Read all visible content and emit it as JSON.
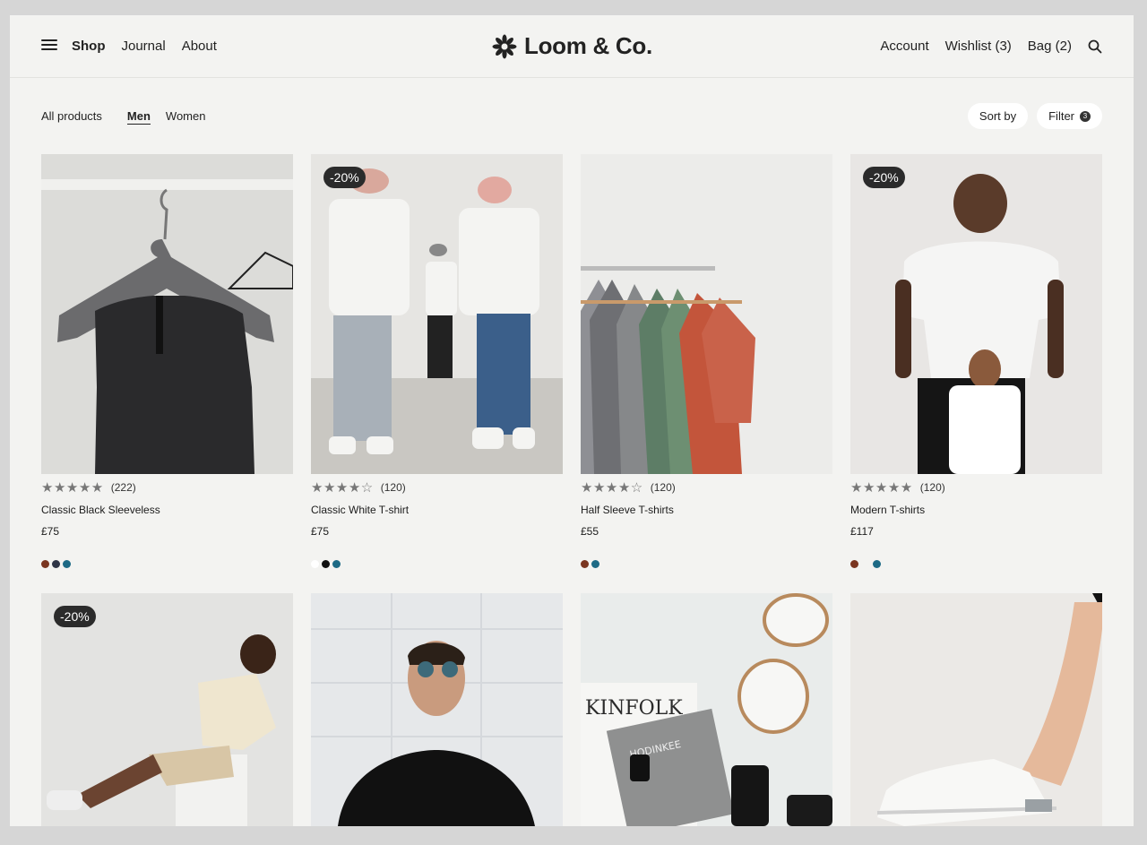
{
  "header": {
    "nav": [
      "Shop",
      "Journal",
      "About"
    ],
    "logo": "Loom & Co.",
    "right": [
      "Account",
      "Wishlist (3)",
      "Bag (2)"
    ]
  },
  "filters": {
    "categories": [
      "All products",
      "Men",
      "Women"
    ],
    "sort_label": "Sort by",
    "filter_label": "Filter",
    "filter_count": "3"
  },
  "products": [
    {
      "name": "Classic Black Sleeveless",
      "price": "£75",
      "rating": 5,
      "reviews": "(222)",
      "badge": "",
      "colors": [
        "#7a3520",
        "#2f3547",
        "#1d6a85"
      ]
    },
    {
      "name": "Classic White T-shirt",
      "price": "£75",
      "rating": 4,
      "reviews": "(120)",
      "badge": "-20%",
      "colors": [
        "#ffffff",
        "#111111",
        "#1d6a85"
      ]
    },
    {
      "name": "Half Sleeve T-shirts",
      "price": "£55",
      "rating": 4,
      "reviews": "(120)",
      "badge": "",
      "colors": [
        "#7a3520",
        "#1d6a85"
      ]
    },
    {
      "name": "Modern T-shirts",
      "price": "£117",
      "rating": 5,
      "reviews": "(120)",
      "badge": "-20%",
      "colors": [
        "#7a3520",
        "#1d6a85"
      ]
    },
    {
      "badge": "-20%"
    },
    {
      "badge": ""
    },
    {
      "badge": "",
      "magazine": "KINFOLK",
      "book": "HODINKEE"
    },
    {
      "badge": ""
    }
  ]
}
